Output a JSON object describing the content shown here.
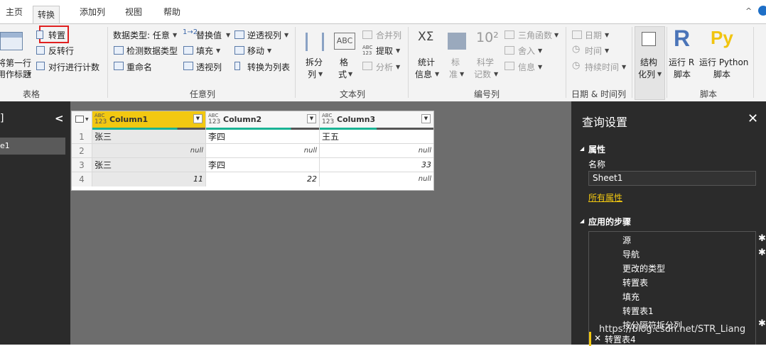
{
  "tabs": [
    "主页",
    "转换",
    "添加列",
    "视图",
    "帮助"
  ],
  "active_tab": "转换",
  "ribbon": {
    "table_group": {
      "label": "表格",
      "use_first_row_l1": "将第一行",
      "use_first_row_l2": "用作标题",
      "transpose": "转置",
      "reverse_rows": "反转行",
      "count_rows": "对行进行计数"
    },
    "any_column_group": {
      "label": "任意列",
      "data_type": "数据类型: 任意",
      "detect_type": "检测数据类型",
      "rename": "重命名",
      "replace_values": "替换值",
      "fill": "填充",
      "pivot": "透视列",
      "unpivot": "逆透视列",
      "move": "移动",
      "to_list": "转换为列表"
    },
    "text_group": {
      "label": "文本列",
      "split_l1": "拆分",
      "split_l2": "列",
      "format_l1": "格",
      "format_l2": "式",
      "merge": "合并列",
      "extract": "提取",
      "parse": "分析"
    },
    "number_group": {
      "label": "编号列",
      "stats_l1": "统计",
      "stats_l2": "信息",
      "standard_l1": "标",
      "standard_l2": "准",
      "scientific_l1": "科学",
      "scientific_l2": "记数",
      "trig": "三角函数",
      "rounding": "舍入",
      "info": "信息"
    },
    "datetime_group": {
      "label": "日期 & 时间列",
      "date": "日期",
      "time": "时间",
      "duration": "持续时间"
    },
    "structured_group": {
      "l1": "结构",
      "l2": "化列"
    },
    "script_group": {
      "label": "脚本",
      "run_r_l1": "运行 R",
      "run_r_l2": "脚本",
      "run_py_l1": "运行 Python",
      "run_py_l2": "脚本",
      "r_glyph": "R",
      "py_glyph": "Py"
    }
  },
  "left_panel": {
    "collapse_glyph": "<",
    "title_fragment": "]",
    "item_fragment": "e1"
  },
  "table": {
    "columns": [
      {
        "type_top": "ABC",
        "type_bottom": "123",
        "name": "Column1"
      },
      {
        "type_top": "ABC",
        "type_bottom": "123",
        "name": "Column2"
      },
      {
        "type_top": "ABC",
        "type_bottom": "123",
        "name": "Column3"
      }
    ],
    "rows": [
      [
        "1",
        "张三",
        "李四",
        "王五"
      ],
      [
        "2",
        "null",
        "null",
        "null"
      ],
      [
        "3",
        "张三",
        "李四",
        "33"
      ],
      [
        "4",
        "11",
        "22",
        "null"
      ]
    ]
  },
  "query_settings": {
    "title": "查询设置",
    "properties_heading": "属性",
    "name_label": "名称",
    "name_value": "Sheet1",
    "all_properties_link": "所有属性",
    "applied_steps_heading": "应用的步骤",
    "steps": [
      "源",
      "导航",
      "更改的类型",
      "转置表",
      "填充",
      "转置表1",
      "按分隔符拆分列",
      "转置表4"
    ]
  },
  "watermark": "https://blog.csdn.net/STR_Liang"
}
